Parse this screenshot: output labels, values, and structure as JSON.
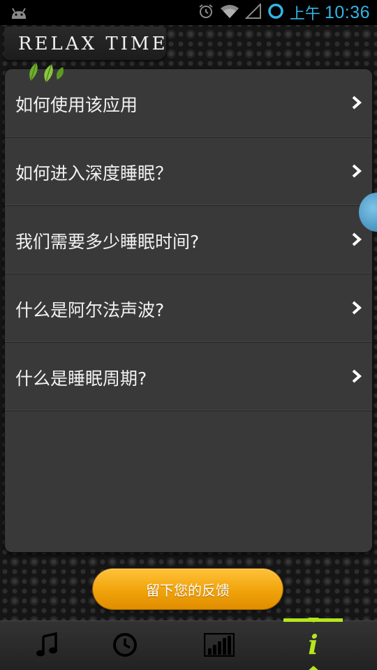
{
  "status_bar": {
    "ampm": "上午",
    "time": "10:36",
    "icons": [
      "android-debug-icon",
      "alarm-icon",
      "wifi-icon",
      "signal-icon",
      "sync-circle-icon"
    ],
    "accent_color": "#33b5e5"
  },
  "header": {
    "title": "RELAX TIME"
  },
  "menu": {
    "items": [
      {
        "label": "如何使用该应用",
        "icon": "chevron-right-icon"
      },
      {
        "label": "如何进入深度睡眠？",
        "icon": "chevron-right-icon"
      },
      {
        "label": "我们需要多少睡眠时间?",
        "icon": "chevron-right-icon"
      },
      {
        "label": "什么是阿尔法声波?",
        "icon": "chevron-right-icon"
      },
      {
        "label": "什么是睡眠周期?",
        "icon": "chevron-right-icon"
      }
    ]
  },
  "feedback": {
    "label": "留下您的反馈",
    "color": "#f0a30a"
  },
  "tabs": {
    "items": [
      {
        "name": "music",
        "icon": "music-note-icon"
      },
      {
        "name": "timer",
        "icon": "clock-icon"
      },
      {
        "name": "stats",
        "icon": "bar-chart-icon"
      },
      {
        "name": "info",
        "icon": "info-icon",
        "glyph": "i",
        "active": true
      }
    ],
    "active_color": "#b5e61d"
  }
}
